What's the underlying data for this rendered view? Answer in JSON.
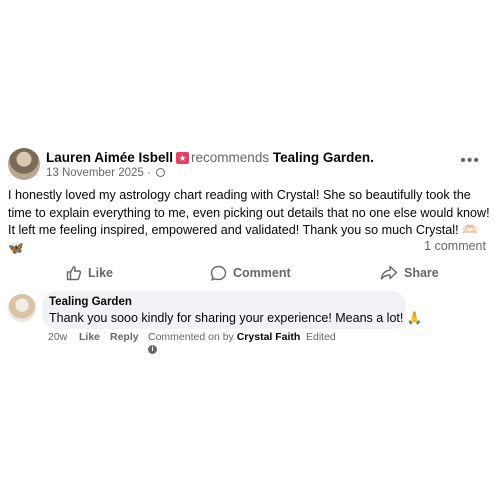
{
  "post": {
    "author": "Lauren Aimée Isbell",
    "recommends_word": "recommends",
    "page_name": "Tealing Garden",
    "page_punct": ".",
    "date": "13 November 2025",
    "separator": "·",
    "more_label": "•••",
    "icons": {
      "recommend": "recommend-star-icon",
      "audience": "globe-icon",
      "more": "more-options-icon"
    },
    "body": "I honestly loved my astrology chart reading with Crystal! She so beautifully took the time to explain everything to me, even picking out details that no one else would know! It left me feeling inspired, empowered and validated! Thank you so much Crystal! 🫶🏻🦋",
    "comment_count": "1 comment"
  },
  "actions": {
    "like": "Like",
    "comment": "Comment",
    "share": "Share"
  },
  "reply": {
    "author": "Tealing Garden",
    "text": "Thank you sooo kindly for sharing your experience! Means a lot! 🙏",
    "time": "20w",
    "like": "Like",
    "reply": "Reply",
    "commented_on_by_prefix": "Commented on by",
    "commented_on_by_name": "Crystal Faith",
    "edited": "Edited",
    "info_glyph": "i"
  },
  "colors": {
    "secondary_text": "#65676b",
    "bubble_bg": "#f0f2f5",
    "recommend_badge": "#e4405f"
  }
}
